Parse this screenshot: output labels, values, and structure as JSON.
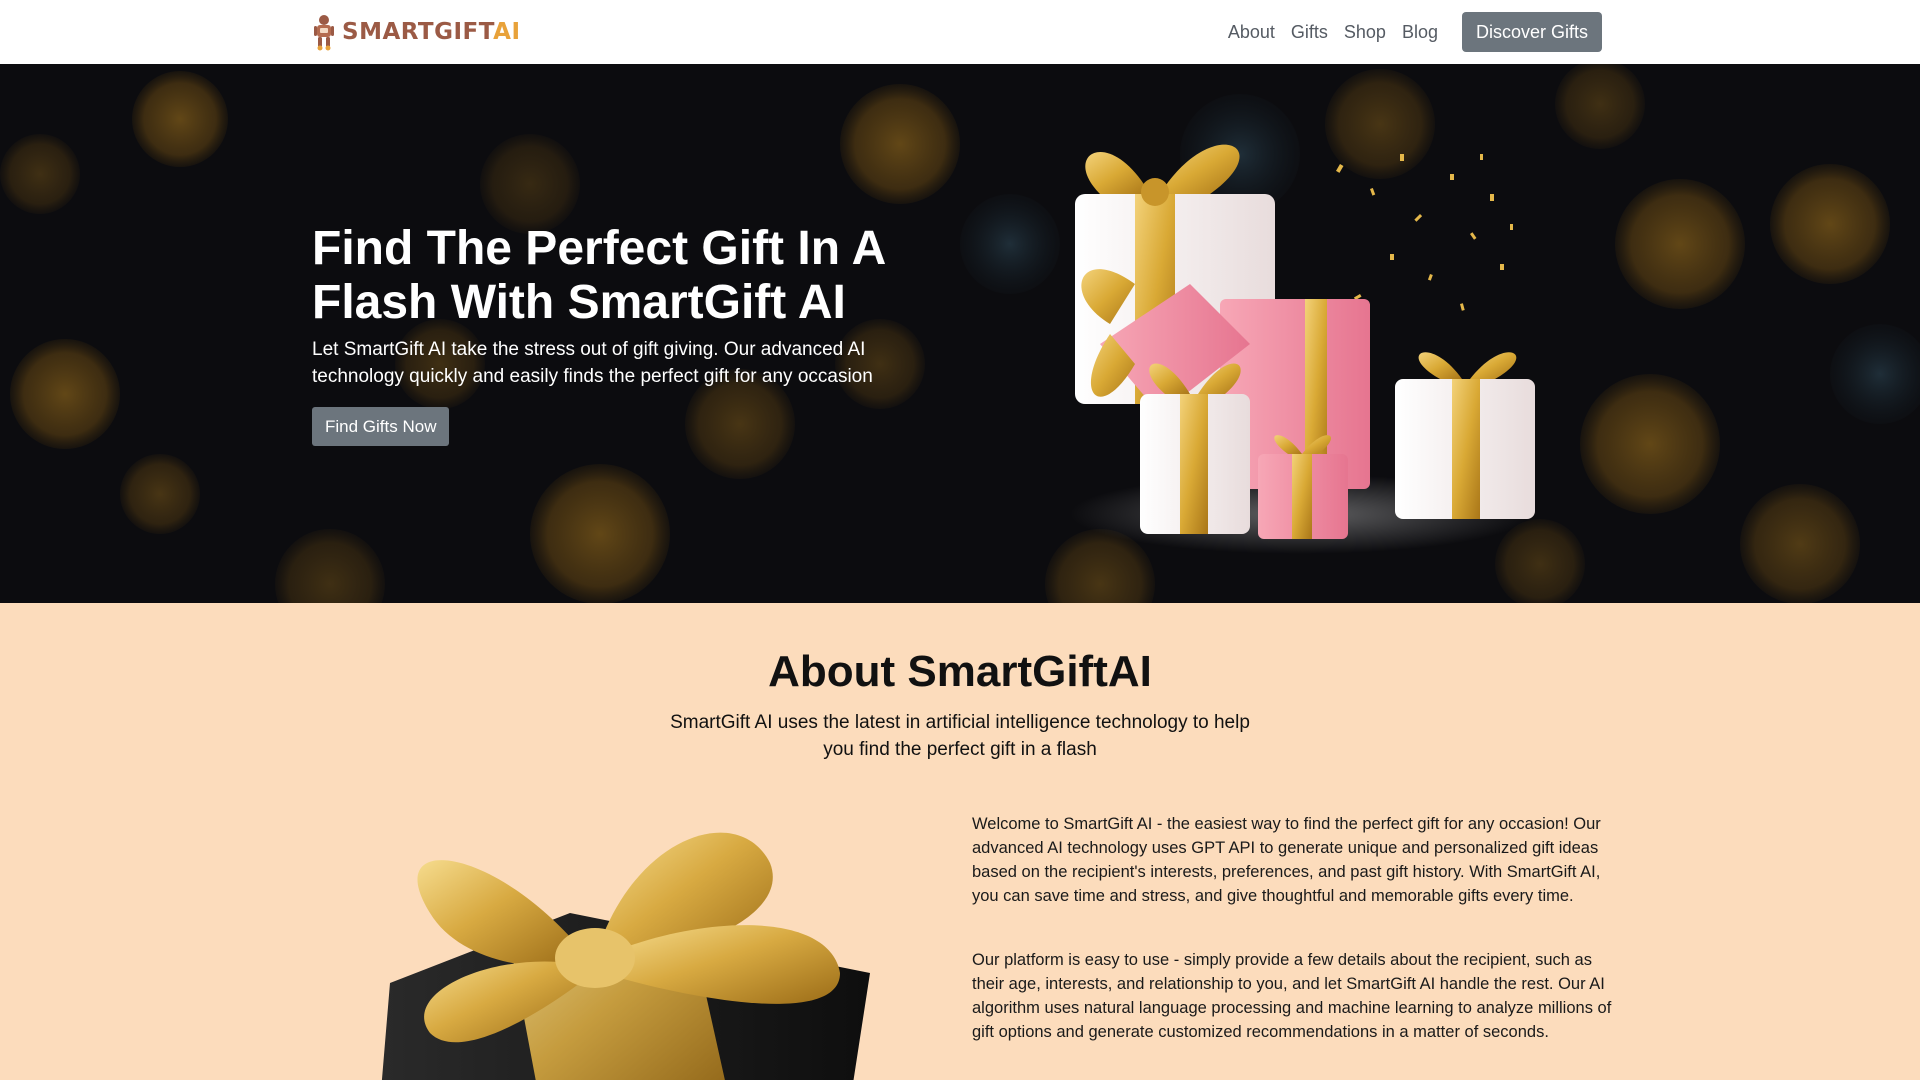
{
  "header": {
    "logo_text": "SMARTGIFT",
    "logo_accent": "AI",
    "nav": [
      {
        "label": "About"
      },
      {
        "label": "Gifts"
      },
      {
        "label": "Shop"
      },
      {
        "label": "Blog"
      }
    ],
    "cta_label": "Discover Gifts"
  },
  "hero": {
    "title": "Find The Perfect Gift In A Flash With SmartGift AI",
    "subtitle": "Let SmartGift AI take the stress out of gift giving. Our advanced AI technology quickly and easily finds the perfect gift for any occasion",
    "button_label": "Find Gifts Now"
  },
  "about": {
    "title": "About SmartGiftAI",
    "subtitle": "SmartGift AI uses the latest in artificial intelligence technology to help you find the perfect gift in a flash",
    "paragraph1": "Welcome to SmartGift AI - the easiest way to find the perfect gift for any occasion! Our advanced AI technology uses GPT API to generate unique and personalized gift ideas based on the recipient's interests, preferences, and past gift history. With SmartGift AI, you can save time and stress, and give thoughtful and memorable gifts every time.",
    "paragraph2": "Our platform is easy to use - simply provide a few details about the recipient, such as their age, interests, and relationship to you, and let SmartGift AI handle the rest. Our AI algorithm uses natural language processing and machine learning to analyze millions of gift options and generate customized recommendations in a matter of seconds."
  },
  "colors": {
    "button_gray": "#6c757d",
    "hero_bg": "#0c0c0f",
    "about_bg": "#fcdcbc",
    "gold": "#d9a935",
    "pink": "#f28aa0"
  },
  "icons": {
    "logo": "robot-logo-icon"
  }
}
